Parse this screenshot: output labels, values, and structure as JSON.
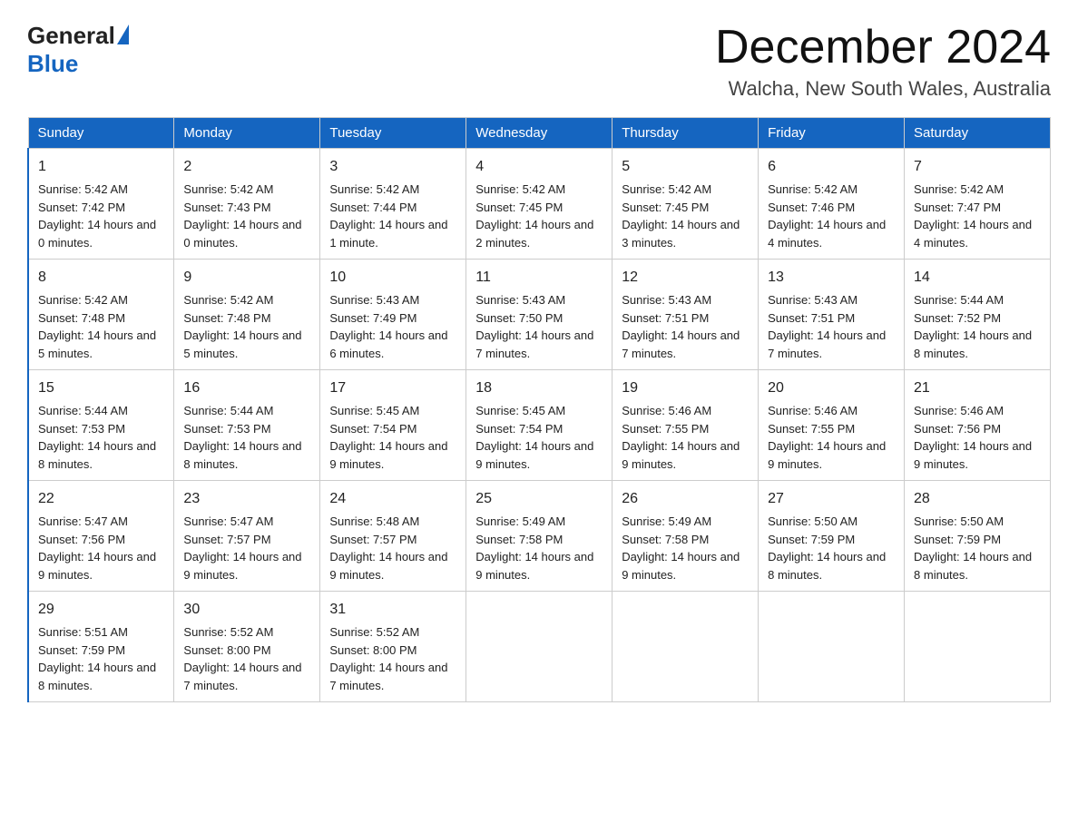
{
  "header": {
    "logo_general": "General",
    "logo_blue": "Blue",
    "title": "December 2024",
    "subtitle": "Walcha, New South Wales, Australia"
  },
  "days_of_week": [
    "Sunday",
    "Monday",
    "Tuesday",
    "Wednesday",
    "Thursday",
    "Friday",
    "Saturday"
  ],
  "weeks": [
    [
      {
        "day": "1",
        "sunrise": "5:42 AM",
        "sunset": "7:42 PM",
        "daylight": "14 hours and 0 minutes."
      },
      {
        "day": "2",
        "sunrise": "5:42 AM",
        "sunset": "7:43 PM",
        "daylight": "14 hours and 0 minutes."
      },
      {
        "day": "3",
        "sunrise": "5:42 AM",
        "sunset": "7:44 PM",
        "daylight": "14 hours and 1 minute."
      },
      {
        "day": "4",
        "sunrise": "5:42 AM",
        "sunset": "7:45 PM",
        "daylight": "14 hours and 2 minutes."
      },
      {
        "day": "5",
        "sunrise": "5:42 AM",
        "sunset": "7:45 PM",
        "daylight": "14 hours and 3 minutes."
      },
      {
        "day": "6",
        "sunrise": "5:42 AM",
        "sunset": "7:46 PM",
        "daylight": "14 hours and 4 minutes."
      },
      {
        "day": "7",
        "sunrise": "5:42 AM",
        "sunset": "7:47 PM",
        "daylight": "14 hours and 4 minutes."
      }
    ],
    [
      {
        "day": "8",
        "sunrise": "5:42 AM",
        "sunset": "7:48 PM",
        "daylight": "14 hours and 5 minutes."
      },
      {
        "day": "9",
        "sunrise": "5:42 AM",
        "sunset": "7:48 PM",
        "daylight": "14 hours and 5 minutes."
      },
      {
        "day": "10",
        "sunrise": "5:43 AM",
        "sunset": "7:49 PM",
        "daylight": "14 hours and 6 minutes."
      },
      {
        "day": "11",
        "sunrise": "5:43 AM",
        "sunset": "7:50 PM",
        "daylight": "14 hours and 7 minutes."
      },
      {
        "day": "12",
        "sunrise": "5:43 AM",
        "sunset": "7:51 PM",
        "daylight": "14 hours and 7 minutes."
      },
      {
        "day": "13",
        "sunrise": "5:43 AM",
        "sunset": "7:51 PM",
        "daylight": "14 hours and 7 minutes."
      },
      {
        "day": "14",
        "sunrise": "5:44 AM",
        "sunset": "7:52 PM",
        "daylight": "14 hours and 8 minutes."
      }
    ],
    [
      {
        "day": "15",
        "sunrise": "5:44 AM",
        "sunset": "7:53 PM",
        "daylight": "14 hours and 8 minutes."
      },
      {
        "day": "16",
        "sunrise": "5:44 AM",
        "sunset": "7:53 PM",
        "daylight": "14 hours and 8 minutes."
      },
      {
        "day": "17",
        "sunrise": "5:45 AM",
        "sunset": "7:54 PM",
        "daylight": "14 hours and 9 minutes."
      },
      {
        "day": "18",
        "sunrise": "5:45 AM",
        "sunset": "7:54 PM",
        "daylight": "14 hours and 9 minutes."
      },
      {
        "day": "19",
        "sunrise": "5:46 AM",
        "sunset": "7:55 PM",
        "daylight": "14 hours and 9 minutes."
      },
      {
        "day": "20",
        "sunrise": "5:46 AM",
        "sunset": "7:55 PM",
        "daylight": "14 hours and 9 minutes."
      },
      {
        "day": "21",
        "sunrise": "5:46 AM",
        "sunset": "7:56 PM",
        "daylight": "14 hours and 9 minutes."
      }
    ],
    [
      {
        "day": "22",
        "sunrise": "5:47 AM",
        "sunset": "7:56 PM",
        "daylight": "14 hours and 9 minutes."
      },
      {
        "day": "23",
        "sunrise": "5:47 AM",
        "sunset": "7:57 PM",
        "daylight": "14 hours and 9 minutes."
      },
      {
        "day": "24",
        "sunrise": "5:48 AM",
        "sunset": "7:57 PM",
        "daylight": "14 hours and 9 minutes."
      },
      {
        "day": "25",
        "sunrise": "5:49 AM",
        "sunset": "7:58 PM",
        "daylight": "14 hours and 9 minutes."
      },
      {
        "day": "26",
        "sunrise": "5:49 AM",
        "sunset": "7:58 PM",
        "daylight": "14 hours and 9 minutes."
      },
      {
        "day": "27",
        "sunrise": "5:50 AM",
        "sunset": "7:59 PM",
        "daylight": "14 hours and 8 minutes."
      },
      {
        "day": "28",
        "sunrise": "5:50 AM",
        "sunset": "7:59 PM",
        "daylight": "14 hours and 8 minutes."
      }
    ],
    [
      {
        "day": "29",
        "sunrise": "5:51 AM",
        "sunset": "7:59 PM",
        "daylight": "14 hours and 8 minutes."
      },
      {
        "day": "30",
        "sunrise": "5:52 AM",
        "sunset": "8:00 PM",
        "daylight": "14 hours and 7 minutes."
      },
      {
        "day": "31",
        "sunrise": "5:52 AM",
        "sunset": "8:00 PM",
        "daylight": "14 hours and 7 minutes."
      },
      null,
      null,
      null,
      null
    ]
  ],
  "labels": {
    "sunrise": "Sunrise:",
    "sunset": "Sunset:",
    "daylight": "Daylight:"
  }
}
